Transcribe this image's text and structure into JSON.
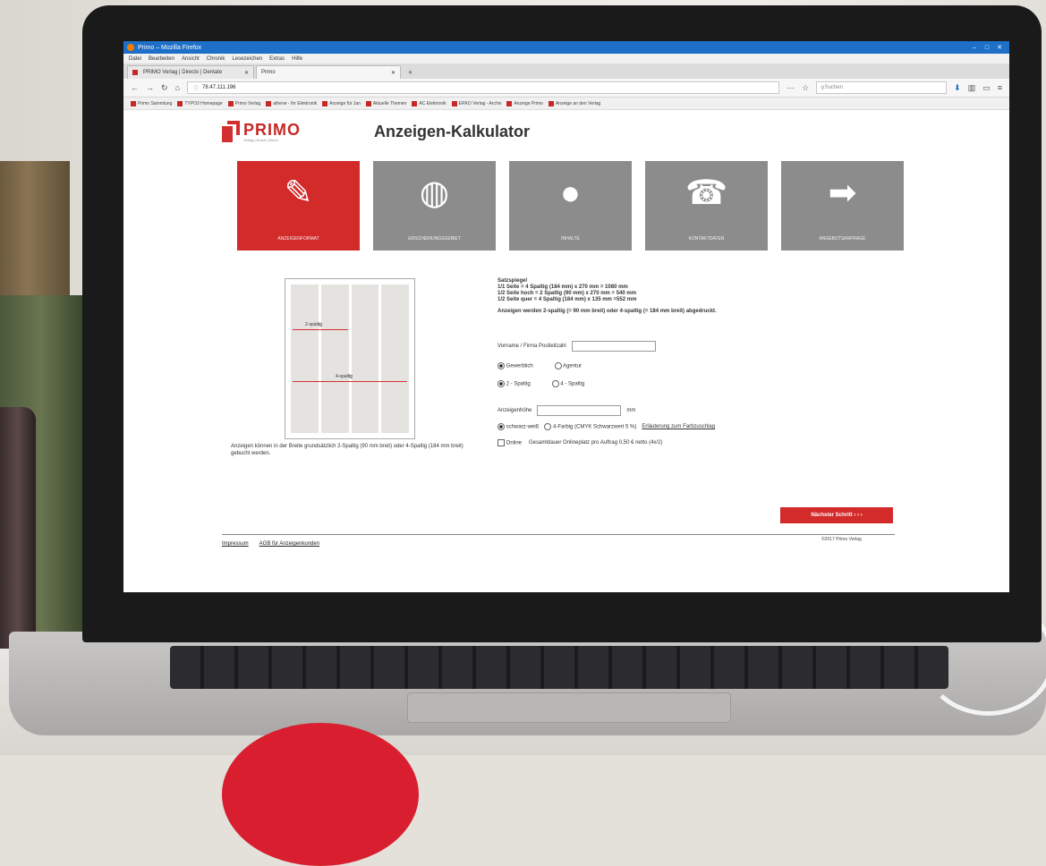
{
  "browser": {
    "window_title": "Primo – Mozilla Firefox",
    "menu": [
      "Datei",
      "Bearbeiten",
      "Ansicht",
      "Chronik",
      "Lesezeichen",
      "Extras",
      "Hilfe"
    ],
    "tabs": [
      {
        "label": "PRIMO Verlag | Directo | Dentate"
      },
      {
        "label": "Primo"
      }
    ],
    "url": "78.47.111.196",
    "search_placeholder": "Suchen",
    "bookmarks": [
      "Primo Sammlung",
      "TYPO3 Homepage",
      "Primo Verlag",
      "athene - Ihr Elektronik",
      "Anzeige für Jan",
      "Aktuelle Themen",
      "AC Elektronik",
      "ERKO Verlag - Archiv",
      "Anzeige Primo",
      "Anzeige an den Verlag"
    ]
  },
  "page": {
    "logo": "PRIMO",
    "logo_sub": "Verlag | Druck | Direct",
    "title": "Anzeigen-Kalkulator",
    "tiles": [
      {
        "label": "ANZEIGENFORMAT",
        "icon": "pen-icon",
        "active": true
      },
      {
        "label": "ERSCHEINUNGSGEBIET",
        "icon": "globe-icon",
        "active": false
      },
      {
        "label": "INHALTE",
        "icon": "speech-bubble-icon",
        "active": false
      },
      {
        "label": "KONTAKTDATEN",
        "icon": "telephone-icon",
        "active": false
      },
      {
        "label": "ANGEBOTSANFRAGE",
        "icon": "arrow-right-icon",
        "active": false
      }
    ],
    "preview": {
      "label_small": "2-spaltig",
      "label_large": "4-spaltig"
    },
    "note": "Anzeigen können in der Breite grundsätzlich 2-Spaltig (90 mm breit) oder 4-Spaltig (184 mm breit) gebucht werden.",
    "rules_heading": "Satzspiegel",
    "rules": [
      "1/1 Seite = 4 Spaltig (184 mm) x 270 mm = 1080 mm",
      "1/2 Seite hoch = 2 Spaltig (90 mm) x 270 mm = 540 mm",
      "1/2 Seite quer = 4 Spaltig (184 mm) x 135 mm =552 mm"
    ],
    "rules_note": "Anzeigen werden 2-spaltig (= 90 mm breit) oder 4-spaltig (= 184 mm breit) abgedruckt.",
    "name_label": "Vorname / Firma Postleitzahl",
    "radio_type": [
      "Gewerblich",
      "Agentur"
    ],
    "radio_cols": [
      "2 - Spaltig",
      "4 - Spaltig"
    ],
    "height_label": "Anzeigenhöhe",
    "height_unit": "mm",
    "color_option": "schwarz-weiß",
    "color_option2": "4-Farbig (CMYK Schwarzwert 5 %)",
    "color_link": "Erläuterung zum Farbzuschlag",
    "online_label": "Online",
    "online_text": "Gesamtdauer Onlineplatz pro Auftrag 0,50 € netto (4x/2)",
    "next_button": "Nächster Schritt  › › ›",
    "footer_links": [
      "Impressum",
      "AGB für Anzeigenkunden"
    ],
    "copyright": "©2017 Primo Verlag"
  },
  "colors": {
    "brand_red": "#d32a2a",
    "tile_gray": "#8c8c8c",
    "titlebar_blue": "#1e6fc7"
  }
}
